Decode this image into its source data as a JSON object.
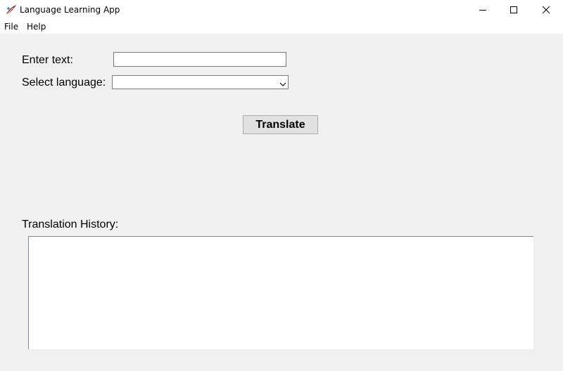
{
  "window": {
    "title": "Language Learning App",
    "app_icon": "feather-quill-icon",
    "controls": [
      "minimize-icon",
      "maximize-icon",
      "close-icon"
    ]
  },
  "menu": {
    "items": [
      {
        "label": "File"
      },
      {
        "label": "Help"
      }
    ]
  },
  "form": {
    "text_label": "Enter text:",
    "text_value": "",
    "text_placeholder": "",
    "language_label": "Select language:",
    "language_selected": "",
    "dropdown_icon": "chevron-down-icon",
    "translate_label": "Translate"
  },
  "history": {
    "label": "Translation History:",
    "content": ""
  }
}
